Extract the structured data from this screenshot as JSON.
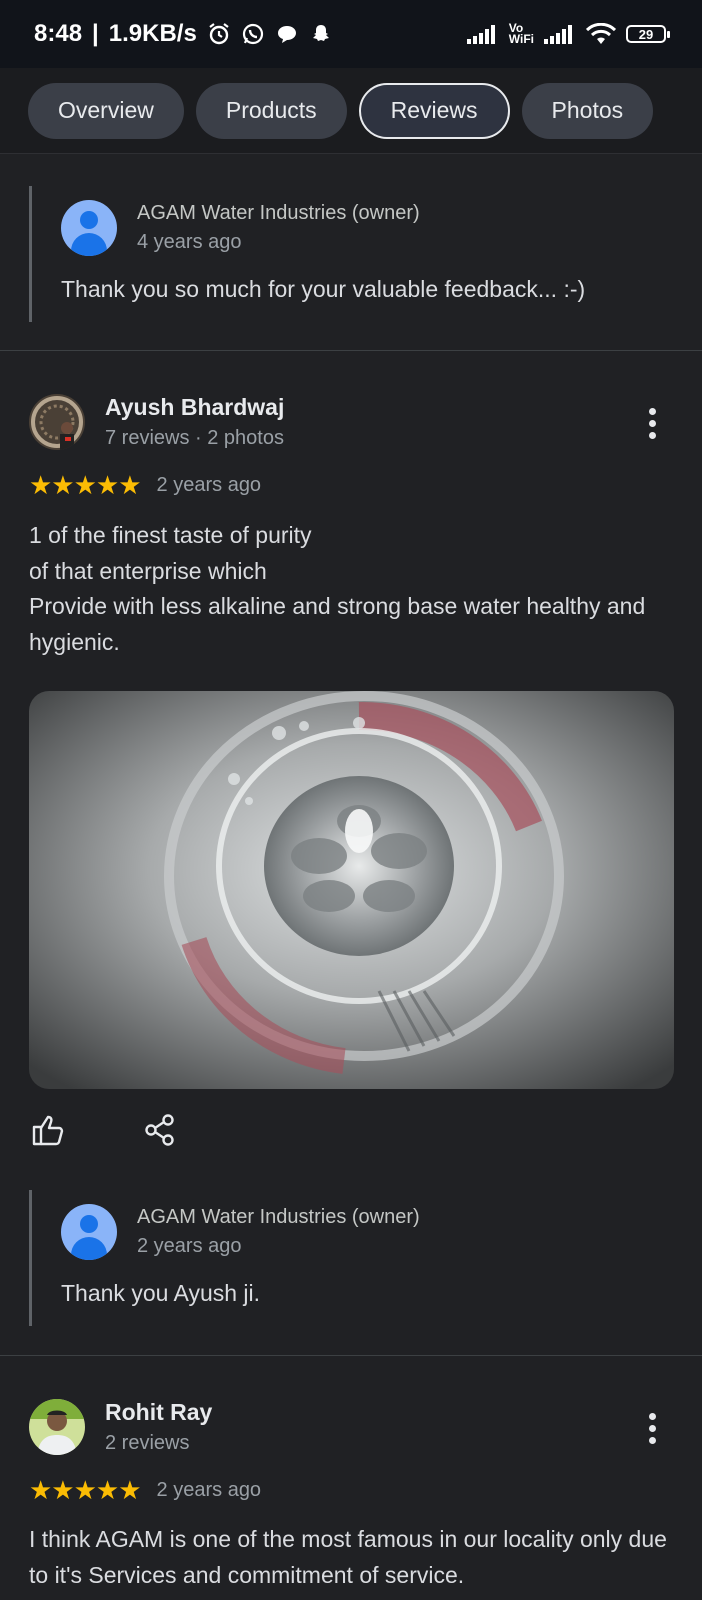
{
  "status_bar": {
    "time": "8:48",
    "net_speed": "1.9KB/s",
    "vowifi_top": "Vo",
    "vowifi_bottom": "WiFi",
    "battery": "29",
    "icons": [
      "alarm-icon",
      "whatsapp-icon",
      "chat-bubble-icon",
      "snapchat-icon",
      "signal-icon",
      "wifi-icon",
      "battery-icon"
    ]
  },
  "tabs": [
    {
      "label": "Overview",
      "active": false
    },
    {
      "label": "Products",
      "active": false
    },
    {
      "label": "Reviews",
      "active": true
    },
    {
      "label": "Photos",
      "active": false
    }
  ],
  "reviews_section": {
    "owner_reply_1": {
      "name": "AGAM Water Industries (owner)",
      "time": "4 years ago",
      "text": "Thank you so much for your valuable feedback... :-)"
    },
    "review_1": {
      "name": "Ayush Bhardwaj",
      "meta": "7 reviews · 2 photos",
      "stars": "★★★★★",
      "rating": 5,
      "time": "2 years ago",
      "text": "1 of the finest taste of purity\nof that enterprise which\nProvide with less alkaline and strong base water healthy and hygienic.",
      "owner_reply": {
        "name": "AGAM Water Industries (owner)",
        "time": "2 years ago",
        "text": "Thank you Ayush ji."
      }
    },
    "review_2": {
      "name": "Rohit Ray",
      "meta": "2 reviews",
      "stars": "★★★★★",
      "rating": 5,
      "time": "2 years ago",
      "text": "I think AGAM is one of the most famous in our locality only due to it's Services and commitment of service."
    }
  },
  "colors": {
    "background": "#202124",
    "star": "#fbbc04",
    "owner_avatar": "#8ab4f8"
  }
}
